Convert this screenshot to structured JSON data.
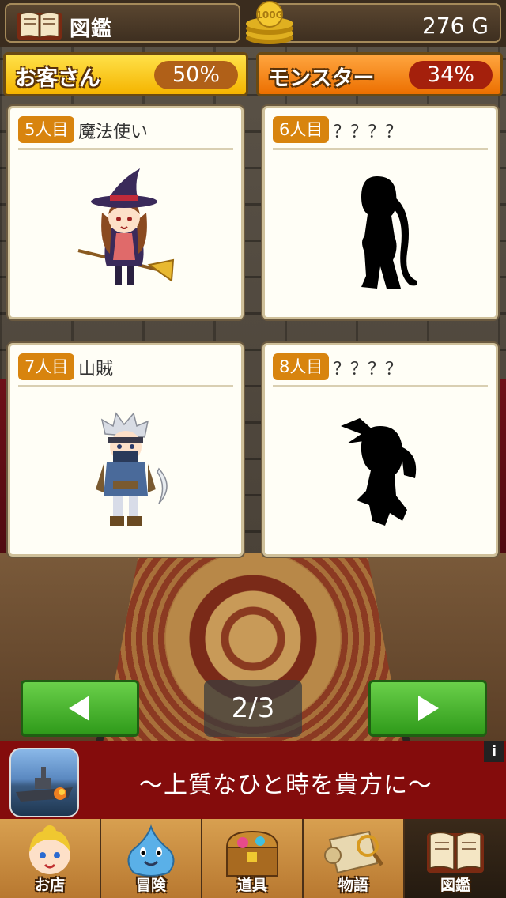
{
  "header": {
    "title": "図鑑",
    "gold": "276 G",
    "coin_label": "100G"
  },
  "tabs": [
    {
      "label": "お客さん",
      "percent": "50%"
    },
    {
      "label": "モンスター",
      "percent": "34%"
    }
  ],
  "cards": [
    {
      "number": "5人目",
      "name": "魔法使い",
      "discovered": true
    },
    {
      "number": "6人目",
      "name": "？？？？",
      "discovered": false
    },
    {
      "number": "7人目",
      "name": "山賊",
      "discovered": true
    },
    {
      "number": "8人目",
      "name": "？？？？",
      "discovered": false
    }
  ],
  "pager": {
    "page": "2/3",
    "prev_icon": "arrow-left-icon",
    "next_icon": "arrow-right-icon"
  },
  "ad": {
    "text": "〜上質なひと時を貴方に〜",
    "info": "i"
  },
  "bottom_nav": [
    {
      "label": "お店",
      "icon": "shopkeeper-icon",
      "active": false
    },
    {
      "label": "冒険",
      "icon": "slime-icon",
      "active": false
    },
    {
      "label": "道具",
      "icon": "treasure-chest-icon",
      "active": false
    },
    {
      "label": "物語",
      "icon": "scroll-icon",
      "active": false
    },
    {
      "label": "図鑑",
      "icon": "book-icon",
      "active": true
    }
  ],
  "colors": {
    "customers_tab": "#f5b400",
    "monsters_tab": "#ec6f00",
    "nav_button": "#2f9a1a",
    "ad_background": "#840c0c"
  }
}
